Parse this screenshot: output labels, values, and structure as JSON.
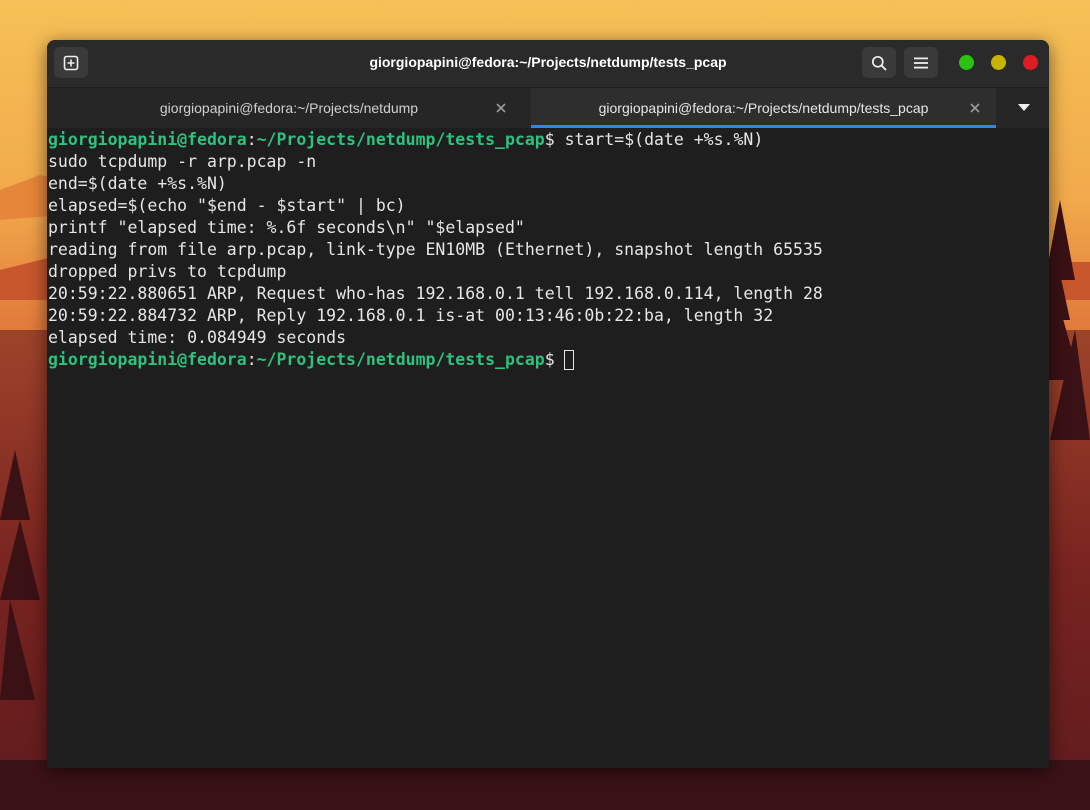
{
  "colors": {
    "window_bg": "#1e1e1e",
    "titlebar_bg": "#2a2a2a",
    "prompt_green": "#2ec27e",
    "tab_underline": "#3584e4",
    "close_red": "#e01b24",
    "minimize_green": "#2ac312",
    "maximize_yellow": "#c8b400"
  },
  "titlebar": {
    "title": "giorgiopapini@fedora:~/Projects/netdump/tests_pcap",
    "new_tab_icon": "new-tab-icon",
    "search_icon": "search-icon",
    "menu_icon": "hamburger-menu-icon"
  },
  "tabs": [
    {
      "label": "giorgiopapini@fedora:~/Projects/netdump",
      "active": false
    },
    {
      "label": "giorgiopapini@fedora:~/Projects/netdump/tests_pcap",
      "active": true
    }
  ],
  "terminal": {
    "prompt_user": "giorgiopapini@fedora",
    "prompt_colon": ":",
    "prompt_path": "~/Projects/netdump/tests_pcap",
    "prompt_dollar": "$ ",
    "first_command": "start=$(date +%s.%N)",
    "lines": [
      "sudo tcpdump -r arp.pcap -n",
      "end=$(date +%s.%N)",
      "elapsed=$(echo \"$end - $start\" | bc)",
      "printf \"elapsed time: %.6f seconds\\n\" \"$elapsed\"",
      "reading from file arp.pcap, link-type EN10MB (Ethernet), snapshot length 65535",
      "dropped privs to tcpdump",
      "20:59:22.880651 ARP, Request who-has 192.168.0.1 tell 192.168.0.114, length 28",
      "20:59:22.884732 ARP, Reply 192.168.0.1 is-at 00:13:46:0b:22:ba, length 32",
      "elapsed time: 0.084949 seconds"
    ]
  }
}
